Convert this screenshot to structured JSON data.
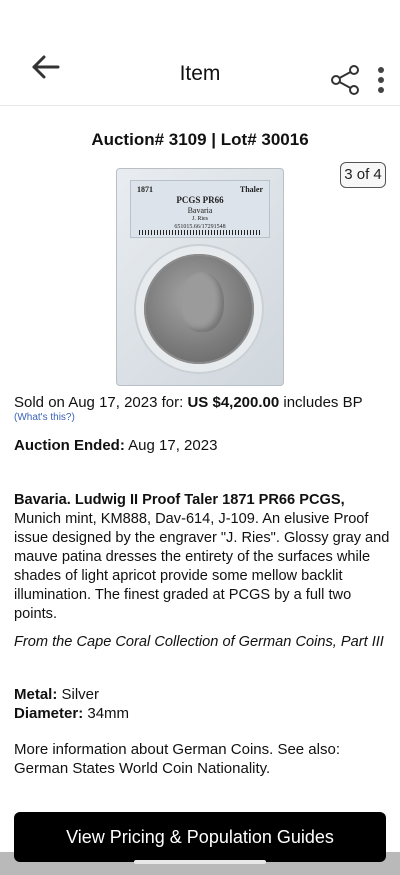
{
  "header": {
    "title": "Item",
    "back_icon": "arrow-left-icon",
    "share_icon": "share-icon",
    "more_icon": "more-vertical-icon"
  },
  "auction": {
    "title": "Auction# 3109 | Lot# 30016",
    "image_counter": "3 of 4"
  },
  "slab_label": {
    "year": "1871",
    "type": "Thaler",
    "grade": "PCGS PR66",
    "region": "Bavaria",
    "mint": "J. Ries",
    "cert": "651015.66/17291548"
  },
  "sale": {
    "prefix": "Sold on Aug 17, 2023 for: ",
    "price": "US $4,200.00",
    "suffix": " includes BP",
    "whats_this": "(What's this?)",
    "ended_label": "Auction Ended:",
    "ended_date": " Aug 17, 2023"
  },
  "description": {
    "title": "Bavaria. Ludwig II Proof Taler 1871 PR66 PCGS,",
    "body": " Munich mint, KM888, Dav-614, J-109. An elusive Proof issue designed by the engraver \"J. Ries\". Glossy gray and mauve patina dresses the entirety of the surfaces while shades of light apricot provide some mellow backlit illumination. The finest graded at PCGS by a full two points.",
    "collection": "From the Cape Coral Collection of German Coins, Part III"
  },
  "specs": {
    "metal_label": "Metal:",
    "metal_value": " Silver",
    "diameter_label": "Diameter:",
    "diameter_value": " 34mm"
  },
  "more_info": "More information about German Coins. See also: German States World Coin Nationality.",
  "cta_label": "View Pricing & Population Guides"
}
